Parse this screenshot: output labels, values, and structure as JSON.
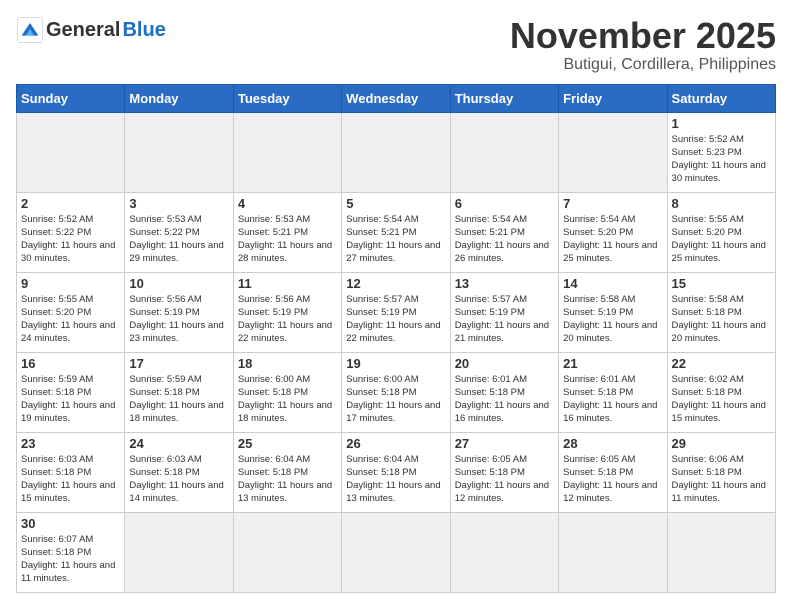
{
  "header": {
    "logo_general": "General",
    "logo_blue": "Blue",
    "month_title": "November 2025",
    "location": "Butigui, Cordillera, Philippines"
  },
  "weekdays": [
    "Sunday",
    "Monday",
    "Tuesday",
    "Wednesday",
    "Thursday",
    "Friday",
    "Saturday"
  ],
  "weeks": [
    [
      {
        "day": "",
        "info": ""
      },
      {
        "day": "",
        "info": ""
      },
      {
        "day": "",
        "info": ""
      },
      {
        "day": "",
        "info": ""
      },
      {
        "day": "",
        "info": ""
      },
      {
        "day": "",
        "info": ""
      },
      {
        "day": "1",
        "info": "Sunrise: 5:52 AM\nSunset: 5:23 PM\nDaylight: 11 hours and 30 minutes."
      }
    ],
    [
      {
        "day": "2",
        "info": "Sunrise: 5:52 AM\nSunset: 5:22 PM\nDaylight: 11 hours and 30 minutes."
      },
      {
        "day": "3",
        "info": "Sunrise: 5:53 AM\nSunset: 5:22 PM\nDaylight: 11 hours and 29 minutes."
      },
      {
        "day": "4",
        "info": "Sunrise: 5:53 AM\nSunset: 5:21 PM\nDaylight: 11 hours and 28 minutes."
      },
      {
        "day": "5",
        "info": "Sunrise: 5:54 AM\nSunset: 5:21 PM\nDaylight: 11 hours and 27 minutes."
      },
      {
        "day": "6",
        "info": "Sunrise: 5:54 AM\nSunset: 5:21 PM\nDaylight: 11 hours and 26 minutes."
      },
      {
        "day": "7",
        "info": "Sunrise: 5:54 AM\nSunset: 5:20 PM\nDaylight: 11 hours and 25 minutes."
      },
      {
        "day": "8",
        "info": "Sunrise: 5:55 AM\nSunset: 5:20 PM\nDaylight: 11 hours and 25 minutes."
      }
    ],
    [
      {
        "day": "9",
        "info": "Sunrise: 5:55 AM\nSunset: 5:20 PM\nDaylight: 11 hours and 24 minutes."
      },
      {
        "day": "10",
        "info": "Sunrise: 5:56 AM\nSunset: 5:19 PM\nDaylight: 11 hours and 23 minutes."
      },
      {
        "day": "11",
        "info": "Sunrise: 5:56 AM\nSunset: 5:19 PM\nDaylight: 11 hours and 22 minutes."
      },
      {
        "day": "12",
        "info": "Sunrise: 5:57 AM\nSunset: 5:19 PM\nDaylight: 11 hours and 22 minutes."
      },
      {
        "day": "13",
        "info": "Sunrise: 5:57 AM\nSunset: 5:19 PM\nDaylight: 11 hours and 21 minutes."
      },
      {
        "day": "14",
        "info": "Sunrise: 5:58 AM\nSunset: 5:19 PM\nDaylight: 11 hours and 20 minutes."
      },
      {
        "day": "15",
        "info": "Sunrise: 5:58 AM\nSunset: 5:18 PM\nDaylight: 11 hours and 20 minutes."
      }
    ],
    [
      {
        "day": "16",
        "info": "Sunrise: 5:59 AM\nSunset: 5:18 PM\nDaylight: 11 hours and 19 minutes."
      },
      {
        "day": "17",
        "info": "Sunrise: 5:59 AM\nSunset: 5:18 PM\nDaylight: 11 hours and 18 minutes."
      },
      {
        "day": "18",
        "info": "Sunrise: 6:00 AM\nSunset: 5:18 PM\nDaylight: 11 hours and 18 minutes."
      },
      {
        "day": "19",
        "info": "Sunrise: 6:00 AM\nSunset: 5:18 PM\nDaylight: 11 hours and 17 minutes."
      },
      {
        "day": "20",
        "info": "Sunrise: 6:01 AM\nSunset: 5:18 PM\nDaylight: 11 hours and 16 minutes."
      },
      {
        "day": "21",
        "info": "Sunrise: 6:01 AM\nSunset: 5:18 PM\nDaylight: 11 hours and 16 minutes."
      },
      {
        "day": "22",
        "info": "Sunrise: 6:02 AM\nSunset: 5:18 PM\nDaylight: 11 hours and 15 minutes."
      }
    ],
    [
      {
        "day": "23",
        "info": "Sunrise: 6:03 AM\nSunset: 5:18 PM\nDaylight: 11 hours and 15 minutes."
      },
      {
        "day": "24",
        "info": "Sunrise: 6:03 AM\nSunset: 5:18 PM\nDaylight: 11 hours and 14 minutes."
      },
      {
        "day": "25",
        "info": "Sunrise: 6:04 AM\nSunset: 5:18 PM\nDaylight: 11 hours and 13 minutes."
      },
      {
        "day": "26",
        "info": "Sunrise: 6:04 AM\nSunset: 5:18 PM\nDaylight: 11 hours and 13 minutes."
      },
      {
        "day": "27",
        "info": "Sunrise: 6:05 AM\nSunset: 5:18 PM\nDaylight: 11 hours and 12 minutes."
      },
      {
        "day": "28",
        "info": "Sunrise: 6:05 AM\nSunset: 5:18 PM\nDaylight: 11 hours and 12 minutes."
      },
      {
        "day": "29",
        "info": "Sunrise: 6:06 AM\nSunset: 5:18 PM\nDaylight: 11 hours and 11 minutes."
      }
    ],
    [
      {
        "day": "30",
        "info": "Sunrise: 6:07 AM\nSunset: 5:18 PM\nDaylight: 11 hours and 11 minutes."
      },
      {
        "day": "",
        "info": ""
      },
      {
        "day": "",
        "info": ""
      },
      {
        "day": "",
        "info": ""
      },
      {
        "day": "",
        "info": ""
      },
      {
        "day": "",
        "info": ""
      },
      {
        "day": "",
        "info": ""
      }
    ]
  ]
}
